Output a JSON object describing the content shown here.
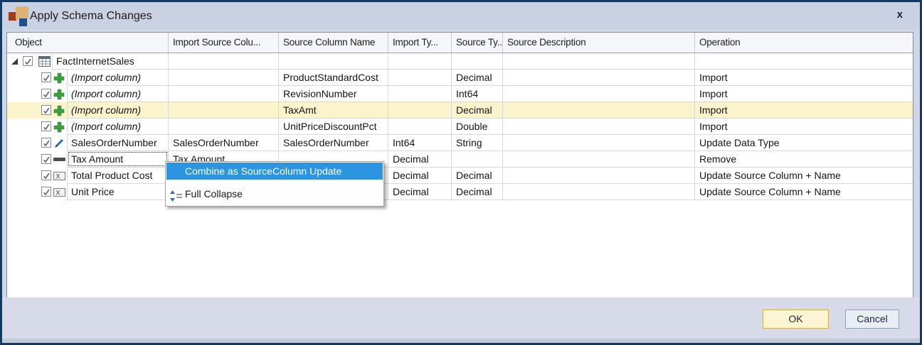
{
  "window": {
    "title": "Apply Schema Changes",
    "close_glyph": "x"
  },
  "logo": {
    "squares": [
      "red-square",
      "tan-square",
      "blue-square"
    ],
    "red": "#a23a20",
    "tan": "#ddb274",
    "blue": "#1f4e8c"
  },
  "colors": {
    "window_border": "#16395f",
    "titlebar_bg": "#cad1e3",
    "row_highlight": "#fbf3cc",
    "menu_highlight": "#2d95e0",
    "ok_button_border": "#d8ae4e",
    "ok_button_bg": "#fcf5d3"
  },
  "grid": {
    "columns": [
      {
        "key": "object",
        "label": "Object"
      },
      {
        "key": "import_source",
        "label": "Import Source Colu..."
      },
      {
        "key": "source_column",
        "label": "Source Column Name"
      },
      {
        "key": "import_type",
        "label": "Import Ty..."
      },
      {
        "key": "source_type",
        "label": "Source Ty..."
      },
      {
        "key": "source_description",
        "label": "Source Description"
      },
      {
        "key": "operation",
        "label": "Operation"
      }
    ],
    "rows": [
      {
        "level": 0,
        "expanded": true,
        "checked": true,
        "icon": "table-icon",
        "object": "FactInternetSales",
        "import_source": "",
        "source_column": "",
        "import_type": "",
        "source_type": "",
        "source_description": "",
        "operation": ""
      },
      {
        "level": 1,
        "checked": true,
        "icon": "add-column-icon",
        "object": "(Import column)",
        "object_italic": true,
        "import_source": "",
        "source_column": "ProductStandardCost",
        "import_type": "",
        "source_type": "Decimal",
        "source_description": "",
        "operation": "Import"
      },
      {
        "level": 1,
        "checked": true,
        "icon": "add-column-icon",
        "object": "(Import column)",
        "object_italic": true,
        "import_source": "",
        "source_column": "RevisionNumber",
        "import_type": "",
        "source_type": "Int64",
        "source_description": "",
        "operation": "Import"
      },
      {
        "level": 1,
        "checked": true,
        "icon": "add-column-icon",
        "object": "(Import column)",
        "object_italic": true,
        "highlighted": true,
        "import_source": "",
        "source_column": "TaxAmt",
        "import_type": "",
        "source_type": "Decimal",
        "source_description": "",
        "operation": "Import"
      },
      {
        "level": 1,
        "checked": true,
        "icon": "add-column-icon",
        "object": "(Import column)",
        "object_italic": true,
        "import_source": "",
        "source_column": "UnitPriceDiscountPct",
        "import_type": "",
        "source_type": "Double",
        "source_description": "",
        "operation": "Import"
      },
      {
        "level": 1,
        "checked": true,
        "icon": "edit-icon",
        "object": "SalesOrderNumber",
        "import_source": "SalesOrderNumber",
        "source_column": "SalesOrderNumber",
        "import_type": "Int64",
        "source_type": "String",
        "source_description": "",
        "operation": "Update Data Type"
      },
      {
        "level": 1,
        "checked": true,
        "icon": "remove-icon",
        "object": "Tax Amount",
        "focused": true,
        "import_source": "Tax Amount",
        "source_column": "",
        "import_type": "Decimal",
        "source_type": "",
        "source_description": "",
        "operation": "Remove"
      },
      {
        "level": 1,
        "checked": true,
        "icon": "rename-icon",
        "object": "Total Product Cost",
        "import_source": "",
        "source_column": "",
        "import_type": "Decimal",
        "source_type": "Decimal",
        "source_description": "",
        "operation": "Update Source Column + Name"
      },
      {
        "level": 1,
        "checked": true,
        "icon": "rename-icon",
        "object": "Unit Price",
        "import_source": "",
        "source_column": "",
        "import_type": "Decimal",
        "source_type": "Decimal",
        "source_description": "",
        "operation": "Update Source Column + Name"
      }
    ]
  },
  "context_menu": {
    "items": [
      {
        "label": "Combine as SourceColumn Update",
        "highlighted": true
      },
      {
        "label": "Full Collapse",
        "icon": "collapse-icon"
      }
    ]
  },
  "footer": {
    "ok_label": "OK",
    "cancel_label": "Cancel"
  }
}
